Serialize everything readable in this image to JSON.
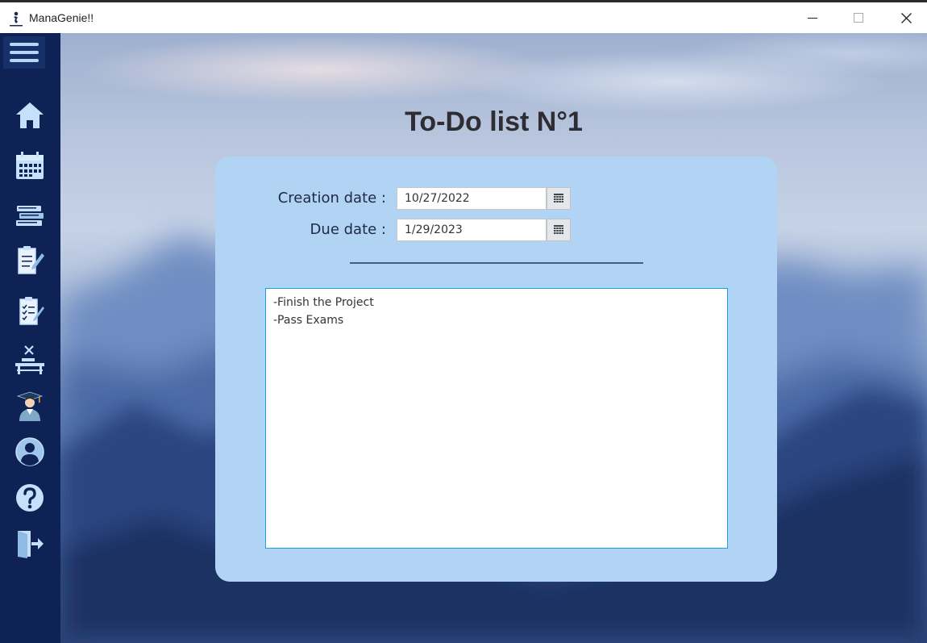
{
  "window": {
    "title": "ManaGenie!!",
    "icon": "managenie-logo-icon",
    "controls": [
      "minimize-icon",
      "maximize-icon",
      "close-icon"
    ]
  },
  "sidebar": {
    "menu_icon": "hamburger-menu-icon",
    "items": [
      {
        "icon": "home-icon"
      },
      {
        "icon": "calendar-icon"
      },
      {
        "icon": "books-icon"
      },
      {
        "icon": "notes-edit-icon"
      },
      {
        "icon": "checklist-icon"
      },
      {
        "icon": "desk-icon"
      },
      {
        "icon": "graduate-icon"
      },
      {
        "icon": "user-profile-icon"
      },
      {
        "icon": "help-icon"
      },
      {
        "icon": "logout-icon"
      }
    ]
  },
  "page": {
    "title": "To-Do list N°1"
  },
  "form": {
    "creation_label": "Creation date :",
    "creation_value": "10/27/2022",
    "due_label": "Due date :",
    "due_value": "1/29/2023",
    "date_picker_icon": "calendar-grid-icon"
  },
  "notes": {
    "lines": [
      "-Finish the Project",
      "-Pass Exams"
    ]
  },
  "colors": {
    "sidebar": "#0f2255",
    "card": "#b1d4f5",
    "focus_border": "#18a3d9",
    "title_text": "#2d2d33"
  }
}
